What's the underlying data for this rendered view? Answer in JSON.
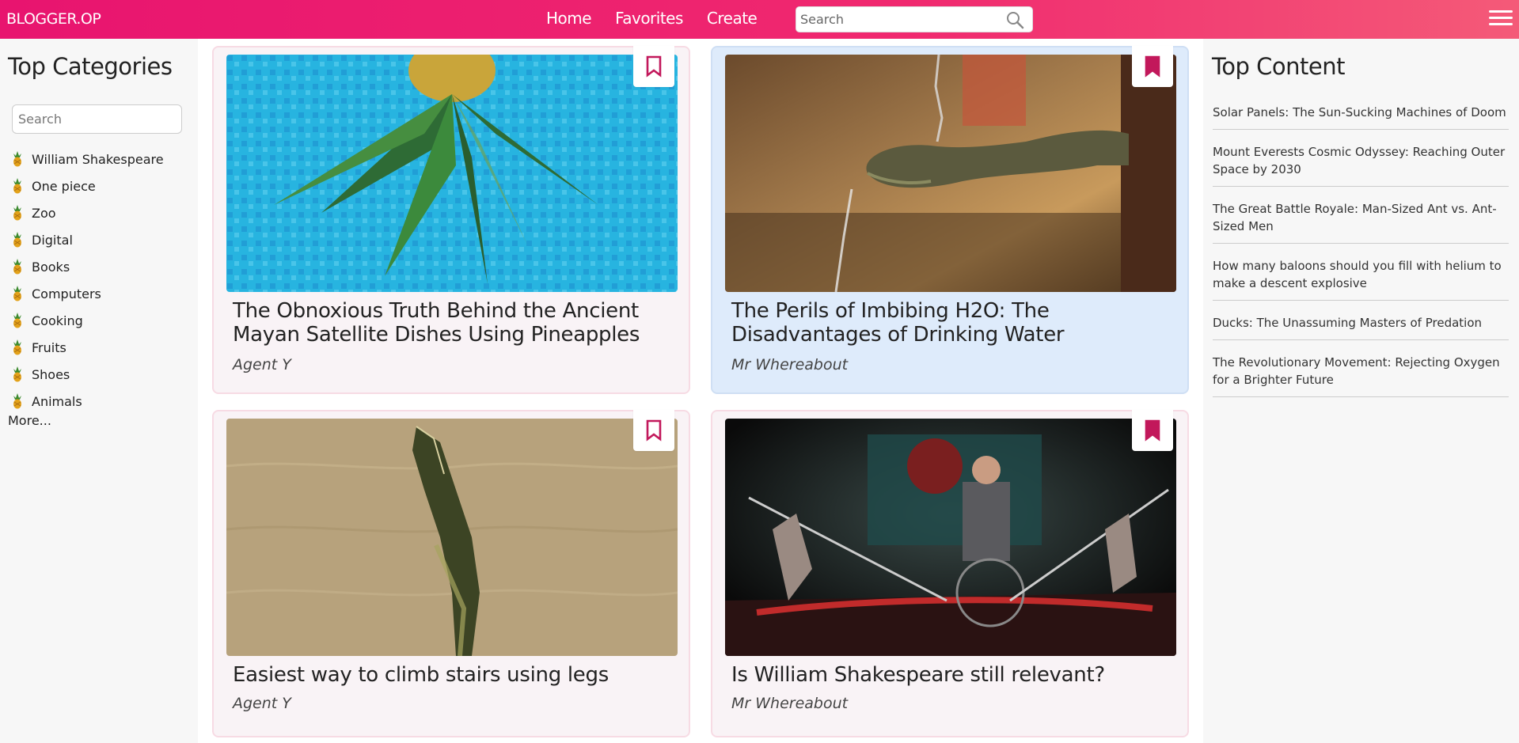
{
  "header": {
    "brand": "BLOGGER.OP",
    "nav": [
      "Home",
      "Favorites",
      "Create"
    ],
    "search_placeholder": "Search"
  },
  "left": {
    "title": "Top Categories",
    "search_placeholder": "Search",
    "categories": [
      "William Shakespeare",
      "One piece",
      "Zoo",
      "Digital",
      "Books",
      "Computers",
      "Cooking",
      "Fruits",
      "Shoes",
      "Animals"
    ],
    "more": "More..."
  },
  "posts": [
    {
      "title": "The Obnoxious Truth Behind the Ancient Mayan Satellite Dishes Using Pineapples",
      "author": "Agent Y",
      "bookmarked": false,
      "image": "pineapple-in-pool"
    },
    {
      "title": "The Perils of Imbibing H2O: The Disadvantages of Drinking Water",
      "author": "Mr Whereabout",
      "bookmarked": true,
      "image": "bronze-hand-fountain"
    },
    {
      "title": "Easiest way to climb stairs using legs",
      "author": "Agent Y",
      "bookmarked": false,
      "image": "crocodile-jumping"
    },
    {
      "title": "Is William Shakespeare still relevant?",
      "author": "Mr Whereabout",
      "bookmarked": true,
      "image": "theatre-stage"
    }
  ],
  "right": {
    "title": "Top Content",
    "items": [
      "Solar Panels: The Sun-Sucking Machines of Doom",
      "Mount Everests Cosmic Odyssey: Reaching Outer Space by 2030",
      "The Great Battle Royale: Man-Sized Ant vs. Ant-Sized Men",
      "How many baloons should you fill with helium to make a descent explosive",
      "Ducks: The Unassuming Masters of Predation",
      "The Revolutionary Movement: Rejecting Oxygen for a Brighter Future"
    ]
  },
  "colors": {
    "brand": "#e8146f",
    "bookmark": "#c2185b",
    "card_bg": "#f9f3f6",
    "card_active_bg": "#deebfb"
  }
}
